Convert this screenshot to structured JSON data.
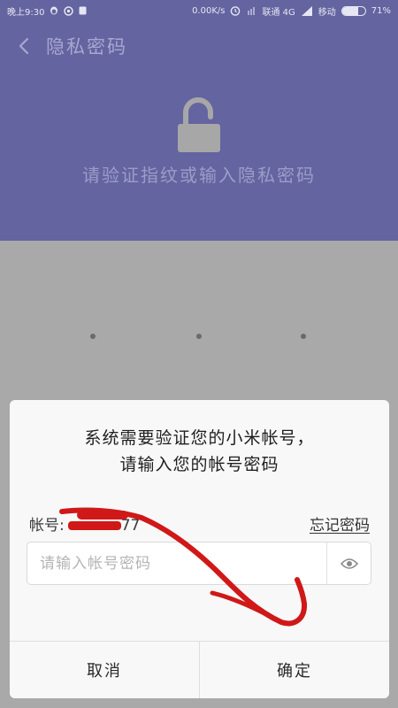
{
  "status_bar": {
    "time": "晚上9:30",
    "network_speed": "0.00K/s",
    "carrier1": "联通 4G",
    "carrier2": "移动",
    "battery_text": "71%",
    "battery_level": 0.71
  },
  "header": {
    "title": "隐私密码",
    "prompt": "请验证指纹或输入隐私密码"
  },
  "dialog": {
    "message_line1": "系统需要验证您的小米帐号，",
    "message_line2": "请输入您的帐号密码",
    "account_label": "帐号:",
    "account_suffix": "77",
    "forgot_link": "忘记密码",
    "password_placeholder": "请输入帐号密码",
    "cancel_label": "取消",
    "confirm_label": "确定"
  },
  "colors": {
    "header_bg": "#6464a0",
    "scrim": "#a9a9a9",
    "annotation": "#d01818"
  },
  "icons": {
    "back": "chevron-left-icon",
    "lock": "unlock-icon",
    "eye": "eye-icon"
  }
}
